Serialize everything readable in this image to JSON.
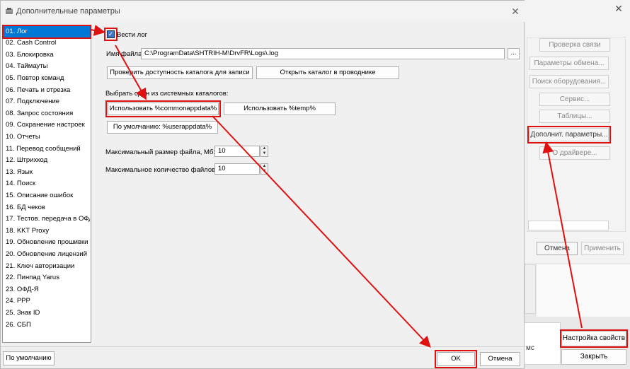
{
  "background": {
    "buttons": [
      {
        "label": "Проверка связи"
      },
      {
        "label": "Параметры обмена..."
      },
      {
        "label": "Поиск оборудования..."
      },
      {
        "label": "Сервис..."
      },
      {
        "label": "Таблицы..."
      },
      {
        "label": "Дополнит. параметры..."
      },
      {
        "label": "О драйвере..."
      }
    ],
    "cancel_label": "Отмена",
    "apply_label": "Применить",
    "status_text": "мс",
    "settings_label": "Настройка свойств",
    "close_label": "Закрыть"
  },
  "dialog": {
    "title": "Дополнительные параметры",
    "list_items": [
      "01. Лог",
      "02. Cash Control",
      "03. Блокировка",
      "04. Таймауты",
      "05. Повтор команд",
      "06. Печать и отрезка",
      "07. Подключение",
      "08. Запрос состояния",
      "09. Сохранение настроек",
      "10. Отчеты",
      "11. Перевод сообщений",
      "12. Штрихкод",
      "13. Язык",
      "14. Поиск",
      "15. Описание ошибок",
      "16. БД чеков",
      "17. Тестов. передача в ОФД",
      "18. KKT Proxy",
      "19. Обновление прошивки",
      "20. Обновление лицензий",
      "21. Ключ авторизации",
      "22. Пинпад Yarus",
      "23. ОФД-Я",
      "24. PPP",
      "25. Знак ID",
      "26. СБП"
    ],
    "log_checkbox_label": "Вести лог",
    "file_name_label": "Имя файла:",
    "file_name_value": "C:\\ProgramData\\SHTRIH-M\\DrvFR\\Logs\\.log",
    "browse_label": "...",
    "check_access_label": "Проверить доступность каталога для записи",
    "open_folder_label": "Открыть каталог в проводнике",
    "choose_catalog_label": "Выбрать один из системных каталогов:",
    "use_common_label": "Использовать %commonappdata%",
    "use_temp_label": "Использовать %temp%",
    "default_user_label": "По умолчанию: %userappdata%",
    "max_size_label": "Максимальный размер файла, Мб:",
    "max_size_value": "10",
    "max_files_label": "Максимальное количество файлов:",
    "max_files_value": "10",
    "default_button": "По умолчанию",
    "ok_button": "OK",
    "cancel_button": "Отмена"
  },
  "colors": {
    "selection": "#0078d7",
    "annotation": "#e01010"
  }
}
